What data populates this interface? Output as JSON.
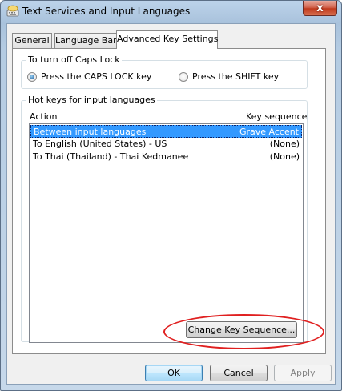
{
  "window": {
    "title": "Text Services and Input Languages",
    "close_glyph": "x"
  },
  "tabs": [
    {
      "label": "General"
    },
    {
      "label": "Language Bar"
    },
    {
      "label": "Advanced Key Settings",
      "active": true
    }
  ],
  "caps_lock_group": {
    "label": "To turn off Caps Lock",
    "options": [
      {
        "label": "Press the CAPS LOCK key",
        "checked": true
      },
      {
        "label": "Press the SHIFT key",
        "checked": false
      }
    ]
  },
  "hotkeys_group": {
    "label": "Hot keys for input languages",
    "columns": [
      "Action",
      "Key sequence"
    ],
    "rows": [
      {
        "action": "Between input languages",
        "sequence": "Grave Accent",
        "selected": true
      },
      {
        "action": "To English (United States) - US",
        "sequence": "(None)"
      },
      {
        "action": "To Thai (Thailand) - Thai Kedmanee",
        "sequence": "(None)"
      }
    ],
    "change_button": "Change Key Sequence..."
  },
  "footer": {
    "ok": "OK",
    "cancel": "Cancel",
    "apply": "Apply"
  },
  "icons": {
    "title_icon": "keyboard-languages-icon"
  },
  "colors": {
    "selection": "#3399ff",
    "annotation": "#e02020"
  }
}
